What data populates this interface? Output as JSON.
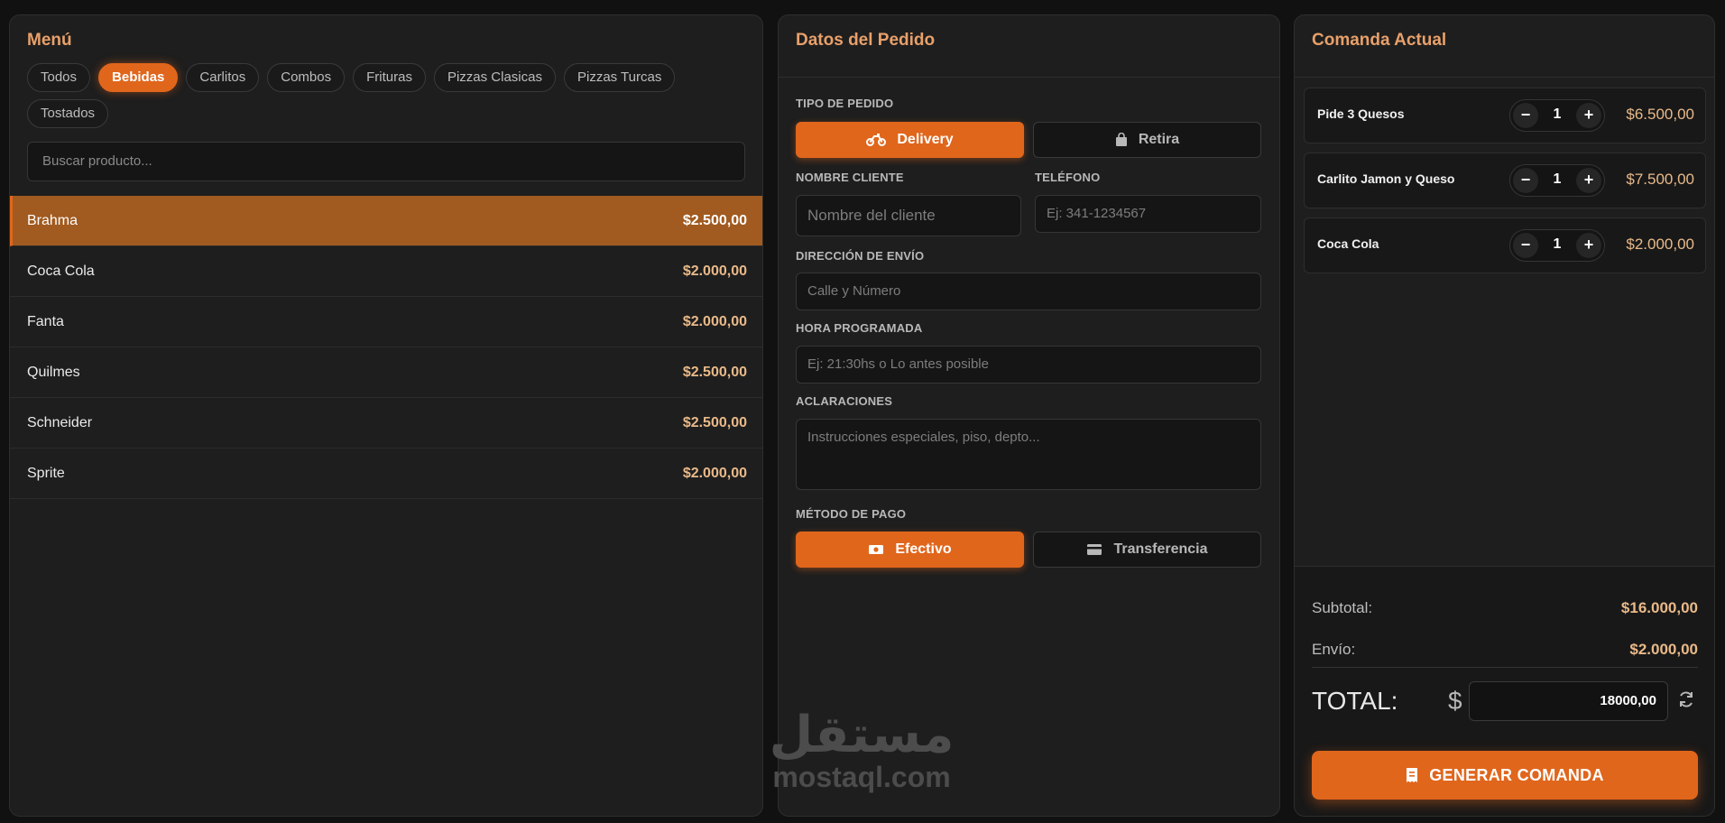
{
  "menu": {
    "title": "Menú",
    "categories": [
      "Todos",
      "Bebidas",
      "Carlitos",
      "Combos",
      "Frituras",
      "Pizzas Clasicas",
      "Pizzas Turcas",
      "Tostados"
    ],
    "active_category": "Bebidas",
    "search_placeholder": "Buscar producto...",
    "products": [
      {
        "name": "Brahma",
        "price": "$2.500,00",
        "selected": true
      },
      {
        "name": "Coca Cola",
        "price": "$2.000,00"
      },
      {
        "name": "Fanta",
        "price": "$2.000,00"
      },
      {
        "name": "Quilmes",
        "price": "$2.500,00"
      },
      {
        "name": "Schneider",
        "price": "$2.500,00"
      },
      {
        "name": "Sprite",
        "price": "$2.000,00"
      }
    ]
  },
  "order": {
    "title": "Datos del Pedido",
    "tipo_label": "TIPO DE PEDIDO",
    "delivery_label": "Delivery",
    "retira_label": "Retira",
    "cliente_label": "NOMBRE CLIENTE",
    "cliente_placeholder": "Nombre del cliente",
    "telefono_label": "TELÉFONO",
    "telefono_placeholder": "Ej: 341-1234567",
    "direccion_label": "DIRECCIÓN DE ENVÍO",
    "direccion_placeholder": "Calle y Número",
    "hora_label": "HORA PROGRAMADA",
    "hora_placeholder": "Ej: 21:30hs o Lo antes posible",
    "aclaraciones_label": "ACLARACIONES",
    "aclaraciones_placeholder": "Instrucciones especiales, piso, depto...",
    "pago_label": "MÉTODO DE PAGO",
    "efectivo_label": "Efectivo",
    "transferencia_label": "Transferencia"
  },
  "ticket": {
    "title": "Comanda Actual",
    "items": [
      {
        "name": "Pide 3 Quesos",
        "qty": "1",
        "price": "$6.500,00"
      },
      {
        "name": "Carlito Jamon y Queso",
        "qty": "1",
        "price": "$7.500,00"
      },
      {
        "name": "Coca Cola",
        "qty": "1",
        "price": "$2.000,00"
      }
    ],
    "subtotal_label": "Subtotal:",
    "subtotal": "$16.000,00",
    "envio_label": "Envío:",
    "envio": "$2.000,00",
    "total_label": "TOTAL:",
    "currency": "$",
    "total_value": "18000,00",
    "generate_label": "GENERAR COMANDA"
  },
  "watermark": {
    "arabic": "مستقل",
    "latin": "mostaql.com"
  },
  "colors": {
    "accent": "#e0661c",
    "price": "#e9b989",
    "background": "#111111",
    "panel": "#1e1e1e"
  },
  "icons": {
    "delivery": "motorcycle-icon",
    "retira": "shopping-bag-icon",
    "efectivo": "cash-icon",
    "transferencia": "credit-card-icon",
    "refresh": "refresh-icon",
    "generate": "receipt-icon"
  }
}
